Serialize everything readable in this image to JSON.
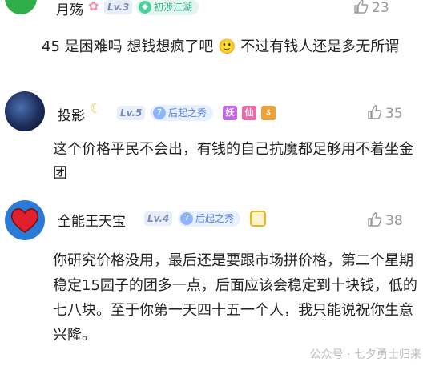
{
  "comments": [
    {
      "name": "月殇",
      "level": "Lv.3",
      "rank": "初涉江湖",
      "likes": "23",
      "text": "45 是困难吗 想钱想疯了吧 🙂 不过有钱人还是多无所谓"
    },
    {
      "name": "投影",
      "level": "Lv.5",
      "rank": "后起之秀",
      "badges": [
        "妖",
        "仙",
        "ऽ"
      ],
      "likes": "35",
      "text": "这个价格平民不会出，有钱的自己抗魔都足够用不着坐金团"
    },
    {
      "name": "全能王天宝",
      "level": "Lv.4",
      "rank": "后起之秀",
      "likes": "38",
      "text": "你研究价格没用，最后还是要跟市场拼价格，第二个星期稳定15园子的团多一点，后面应该会稳定到十块钱，低的七八块。至于你第一天四十五一个人，我只能说祝你生意兴隆。"
    }
  ],
  "watermark": "公众号 · 七夕勇士归来",
  "colors": {
    "badge_purple": "#c267e8",
    "badge_pink": "#e86aa8",
    "badge_orange": "#f0a23a"
  }
}
